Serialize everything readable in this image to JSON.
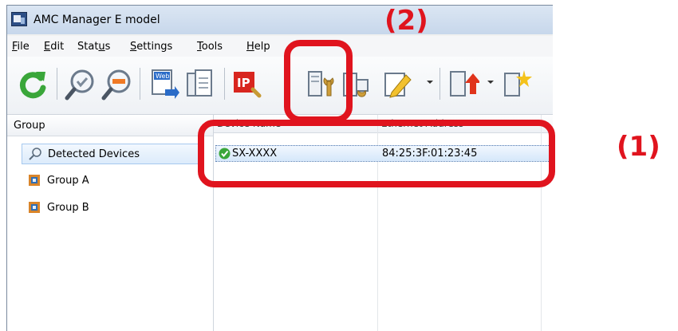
{
  "window": {
    "title": "AMC Manager E model"
  },
  "menu": [
    {
      "label_pre": "",
      "label_acc": "F",
      "label_post": "ile"
    },
    {
      "label_pre": "",
      "label_acc": "E",
      "label_post": "dit"
    },
    {
      "label_pre": "Stat",
      "label_acc": "u",
      "label_post": "s"
    },
    {
      "label_pre": "",
      "label_acc": "S",
      "label_post": "ettings"
    },
    {
      "label_pre": "",
      "label_acc": "T",
      "label_post": "ools"
    },
    {
      "label_pre": "",
      "label_acc": "H",
      "label_post": "elp"
    }
  ],
  "toolbar": {
    "web_icon_text": "Web",
    "ip_icon_text": "IP"
  },
  "group_pane": {
    "header": "Group",
    "items": [
      {
        "label": "Detected Devices",
        "icon": "search-icon",
        "selected": true
      },
      {
        "label": "Group A",
        "icon": "group-icon",
        "selected": false
      },
      {
        "label": "Group B",
        "icon": "group-icon",
        "selected": false
      }
    ]
  },
  "device_pane": {
    "columns": [
      "Device Name",
      "Ethernet Address"
    ],
    "rows": [
      {
        "name": "SX-XXXX",
        "mac": "84:25:3F:01:23:45",
        "status": "ok"
      }
    ]
  },
  "annotations": {
    "callout_1": "(1)",
    "callout_2": "(2)"
  },
  "colors": {
    "callout": "#e0141e",
    "selection": "#d5e7fa",
    "ok_green": "#3aa63a"
  }
}
